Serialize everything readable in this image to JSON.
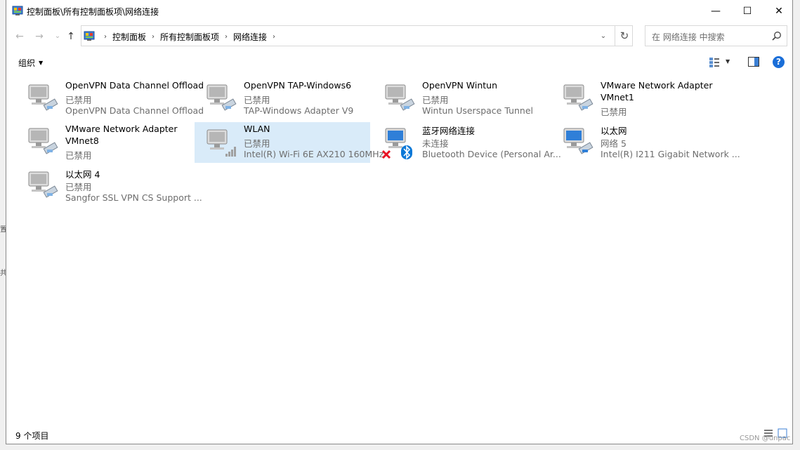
{
  "window": {
    "title": "控制面板\\所有控制面板项\\网络连接",
    "minimize_glyph": "—",
    "maximize_glyph": "☐",
    "close_glyph": "✕"
  },
  "nav": {
    "back_glyph": "←",
    "forward_glyph": "→",
    "recent_glyph": "⌄",
    "up_glyph": "↑",
    "breadcrumbs": [
      "控制面板",
      "所有控制面板项",
      "网络连接"
    ],
    "crumb_separator": "›",
    "dropdown_glyph": "⌄",
    "refresh_glyph": "↻"
  },
  "search": {
    "placeholder": "在 网络连接 中搜索"
  },
  "toolbar": {
    "organize_label": "组织",
    "organize_caret": "▼",
    "view_dropdown_glyph": "▼",
    "help_glyph": "?"
  },
  "connections": [
    {
      "lines": [
        "OpenVPN Data Channel Offload",
        "已禁用",
        "OpenVPN Data Channel Offload"
      ],
      "icon": "network-adapter-disabled-icon"
    },
    {
      "lines": [
        "OpenVPN TAP-Windows6",
        "已禁用",
        "TAP-Windows Adapter V9"
      ],
      "icon": "network-adapter-disabled-icon"
    },
    {
      "lines": [
        "OpenVPN Wintun",
        "已禁用",
        "Wintun Userspace Tunnel"
      ],
      "icon": "network-adapter-disabled-icon"
    },
    {
      "lines": [
        "VMware Network Adapter",
        "VMnet1",
        "已禁用"
      ],
      "icon": "network-adapter-disabled-icon"
    },
    {
      "lines": [
        "VMware Network Adapter",
        "VMnet8",
        "已禁用"
      ],
      "icon": "network-adapter-disabled-icon"
    },
    {
      "lines": [
        "WLAN",
        "已禁用",
        "Intel(R) Wi-Fi 6E AX210 160MHz"
      ],
      "icon": "wifi-adapter-disabled-icon",
      "selected": true
    },
    {
      "lines": [
        "蓝牙网络连接",
        "未连接",
        "Bluetooth Device (Personal Ar..."
      ],
      "icon": "bluetooth-adapter-disconnected-icon"
    },
    {
      "lines": [
        "以太网",
        "网络 5",
        "Intel(R) I211 Gigabit Network ..."
      ],
      "icon": "ethernet-adapter-connected-icon"
    },
    {
      "lines": [
        "以太网 4",
        "已禁用",
        "Sangfor SSL VPN CS Support ..."
      ],
      "icon": "network-adapter-disabled-icon"
    }
  ],
  "status": {
    "item_count": "9 个项目"
  },
  "watermark": "CSDN @unpac",
  "outside": [
    "置",
    "共"
  ],
  "colors": {
    "selection": "#d9ebf9",
    "secondary_text": "#6d6d6d",
    "help_blue": "#1a6ed8",
    "disconnect_red": "#e81123",
    "bluetooth_blue": "#0a78d7"
  }
}
